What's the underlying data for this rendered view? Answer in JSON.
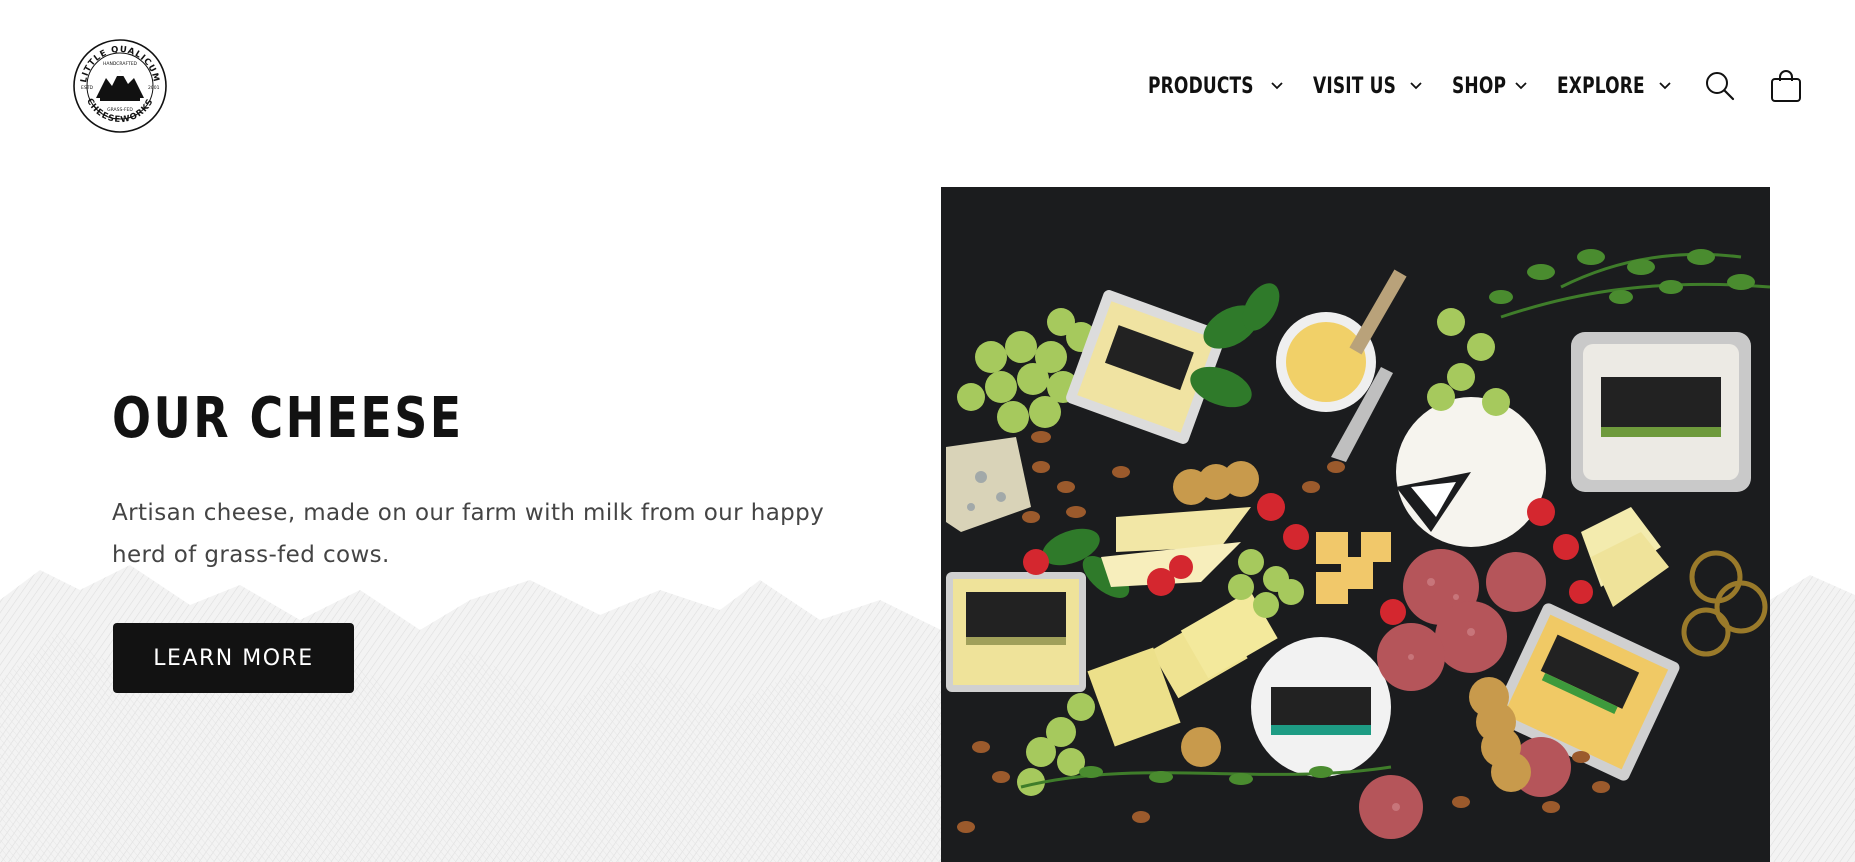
{
  "brand": {
    "logo_alt": "Little Qualicum Cheeseworks",
    "logo_lines": {
      "top": "LITTLE QUALICUM",
      "inner_top": "HANDCRAFTED",
      "inner_bottom": "GRASS-FED",
      "bottom": "CHEESEWORKS",
      "left": "ESTD",
      "right": "2001"
    }
  },
  "nav": {
    "items": [
      {
        "label": "PRODUCTS"
      },
      {
        "label": "VISIT US"
      },
      {
        "label": "SHOP"
      },
      {
        "label": "EXPLORE"
      }
    ]
  },
  "icons": {
    "search": "search-icon",
    "cart": "cart-icon",
    "chevron": "chevron-down-icon"
  },
  "hero": {
    "title": "OUR CHEESE",
    "text": "Artisan cheese, made on our farm with milk from our happy herd of grass-fed cows.",
    "button": "LEARN MORE",
    "image_alt": "Cheese board"
  },
  "colors": {
    "text": "#121212",
    "button_bg": "#121212",
    "image_bg": "#1b1c1e",
    "grape": "#9cc35a",
    "cheese": "#efe39a"
  }
}
